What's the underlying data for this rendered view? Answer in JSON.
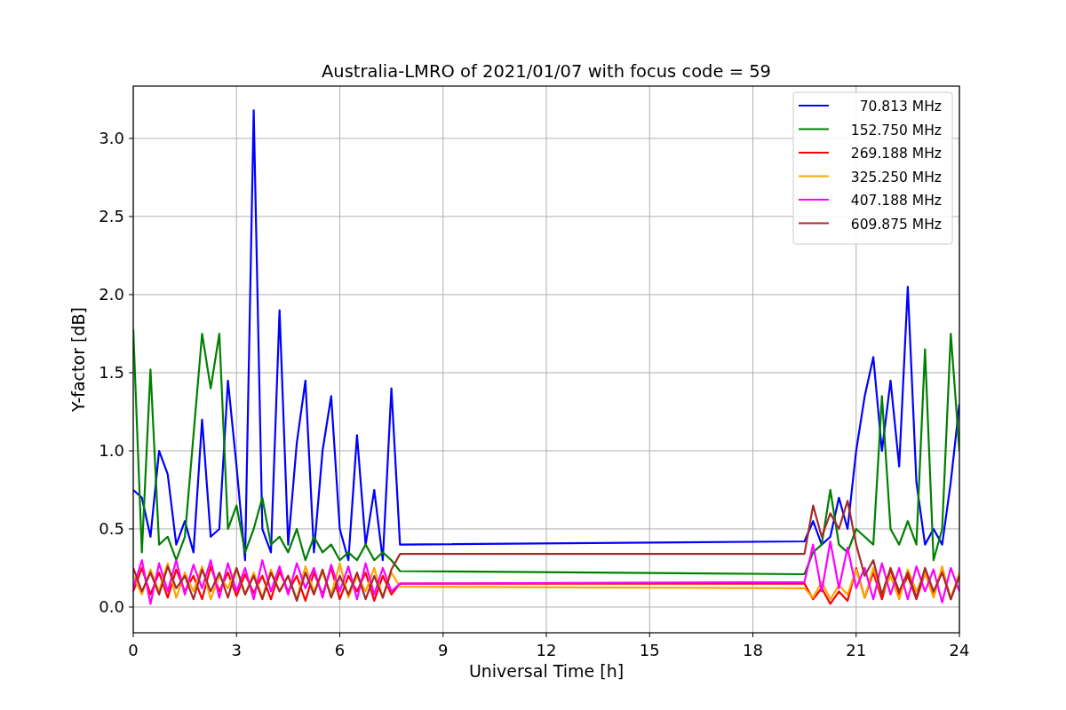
{
  "chart_data": {
    "type": "line",
    "title": "Australia-LMRO of 2021/01/07 with focus code = 59",
    "xlabel": "Universal Time [h]",
    "ylabel": "Y-factor [dB]",
    "x": [
      0,
      0.25,
      0.5,
      0.75,
      1,
      1.25,
      1.5,
      1.75,
      2,
      2.25,
      2.5,
      2.75,
      3,
      3.25,
      3.5,
      3.75,
      4,
      4.25,
      4.5,
      4.75,
      5,
      5.25,
      5.5,
      5.75,
      6,
      6.25,
      6.5,
      6.75,
      7,
      7.25,
      7.5,
      7.75,
      19.5,
      19.75,
      20,
      20.25,
      20.5,
      20.75,
      21,
      21.25,
      21.5,
      21.75,
      22,
      22.25,
      22.5,
      22.75,
      23,
      23.25,
      23.5,
      23.75,
      24
    ],
    "series": [
      {
        "name": "70.813 MHz",
        "color": "#0000ff",
        "values": [
          0.75,
          0.7,
          0.45,
          1.0,
          0.85,
          0.4,
          0.55,
          0.35,
          1.2,
          0.45,
          0.5,
          1.45,
          0.9,
          0.3,
          3.18,
          0.5,
          0.35,
          1.9,
          0.4,
          1.05,
          1.45,
          0.35,
          1.0,
          1.35,
          0.5,
          0.3,
          1.1,
          0.4,
          0.75,
          0.3,
          1.4,
          0.4,
          0.42,
          0.55,
          0.4,
          0.45,
          0.7,
          0.5,
          1.0,
          1.35,
          1.6,
          1.0,
          1.45,
          0.9,
          2.05,
          0.8,
          0.4,
          0.5,
          0.4,
          0.8,
          1.3
        ]
      },
      {
        "name": "152.750 MHz",
        "color": "#008000",
        "values": [
          1.78,
          0.35,
          1.52,
          0.4,
          0.45,
          0.3,
          0.45,
          1.1,
          1.75,
          1.4,
          1.75,
          0.5,
          0.65,
          0.35,
          0.5,
          0.7,
          0.4,
          0.45,
          0.35,
          0.5,
          0.3,
          0.45,
          0.35,
          0.4,
          0.3,
          0.35,
          0.3,
          0.4,
          0.3,
          0.35,
          0.3,
          0.23,
          0.21,
          0.35,
          0.4,
          0.75,
          0.4,
          0.35,
          0.5,
          0.45,
          0.4,
          1.35,
          0.5,
          0.4,
          0.55,
          0.4,
          1.65,
          0.3,
          0.5,
          1.75,
          1.0
        ]
      },
      {
        "name": "269.188 MHz",
        "color": "#ff0000",
        "values": [
          0.1,
          0.25,
          0.08,
          0.22,
          0.06,
          0.24,
          0.1,
          0.2,
          0.05,
          0.26,
          0.1,
          0.22,
          0.07,
          0.21,
          0.09,
          0.2,
          0.05,
          0.23,
          0.1,
          0.2,
          0.04,
          0.22,
          0.08,
          0.25,
          0.05,
          0.2,
          0.1,
          0.22,
          0.04,
          0.2,
          0.08,
          0.15,
          0.15,
          0.05,
          0.12,
          0.02,
          0.1,
          0.04,
          0.25,
          0.06,
          0.22,
          0.05,
          0.24,
          0.08,
          0.2,
          0.05,
          0.22,
          0.07,
          0.25,
          0.05,
          0.2
        ]
      },
      {
        "name": "325.250 MHz",
        "color": "#ffa500",
        "values": [
          0.2,
          0.08,
          0.24,
          0.1,
          0.28,
          0.06,
          0.22,
          0.1,
          0.26,
          0.05,
          0.2,
          0.12,
          0.25,
          0.08,
          0.22,
          0.06,
          0.24,
          0.1,
          0.2,
          0.05,
          0.26,
          0.1,
          0.22,
          0.08,
          0.28,
          0.06,
          0.2,
          0.1,
          0.25,
          0.06,
          0.22,
          0.13,
          0.12,
          0.06,
          0.16,
          0.05,
          0.14,
          0.08,
          0.24,
          0.06,
          0.25,
          0.08,
          0.2,
          0.05,
          0.24,
          0.1,
          0.22,
          0.06,
          0.26,
          0.05,
          0.22
        ]
      },
      {
        "name": "407.188 MHz",
        "color": "#ff00ff",
        "values": [
          0.12,
          0.3,
          0.02,
          0.28,
          0.1,
          0.3,
          0.08,
          0.27,
          0.12,
          0.3,
          0.06,
          0.28,
          0.1,
          0.25,
          0.05,
          0.3,
          0.1,
          0.26,
          0.08,
          0.28,
          0.12,
          0.25,
          0.06,
          0.27,
          0.1,
          0.26,
          0.05,
          0.28,
          0.08,
          0.25,
          0.1,
          0.15,
          0.16,
          0.4,
          0.1,
          0.42,
          0.12,
          0.38,
          0.12,
          0.25,
          0.05,
          0.28,
          0.08,
          0.25,
          0.05,
          0.26,
          0.1,
          0.24,
          0.03,
          0.25,
          0.1
        ]
      },
      {
        "name": "609.875 MHz",
        "color": "#a52a2a",
        "values": [
          0.25,
          0.1,
          0.22,
          0.08,
          0.26,
          0.12,
          0.2,
          0.05,
          0.24,
          0.1,
          0.22,
          0.06,
          0.25,
          0.08,
          0.2,
          0.05,
          0.22,
          0.1,
          0.2,
          0.04,
          0.22,
          0.08,
          0.24,
          0.06,
          0.2,
          0.08,
          0.22,
          0.05,
          0.2,
          0.06,
          0.24,
          0.34,
          0.34,
          0.65,
          0.45,
          0.6,
          0.5,
          0.68,
          0.4,
          0.2,
          0.3,
          0.08,
          0.25,
          0.1,
          0.22,
          0.06,
          0.25,
          0.1,
          0.22,
          0.05,
          0.2
        ]
      }
    ],
    "grid": true,
    "legend": true,
    "xlim": [
      0,
      24
    ],
    "ylim": [
      -0.165,
      3.335
    ],
    "xticks": [
      0,
      3,
      6,
      9,
      12,
      15,
      18,
      21,
      24
    ],
    "yticks": [
      {
        "value": 0,
        "label": "0.0"
      },
      {
        "value": 0.5,
        "label": "0.5"
      },
      {
        "value": 1,
        "label": "1.0"
      },
      {
        "value": 1.5,
        "label": "1.5"
      },
      {
        "value": 2,
        "label": "2.0"
      },
      {
        "value": 2.5,
        "label": "2.5"
      },
      {
        "value": 3,
        "label": "3.0"
      }
    ]
  }
}
